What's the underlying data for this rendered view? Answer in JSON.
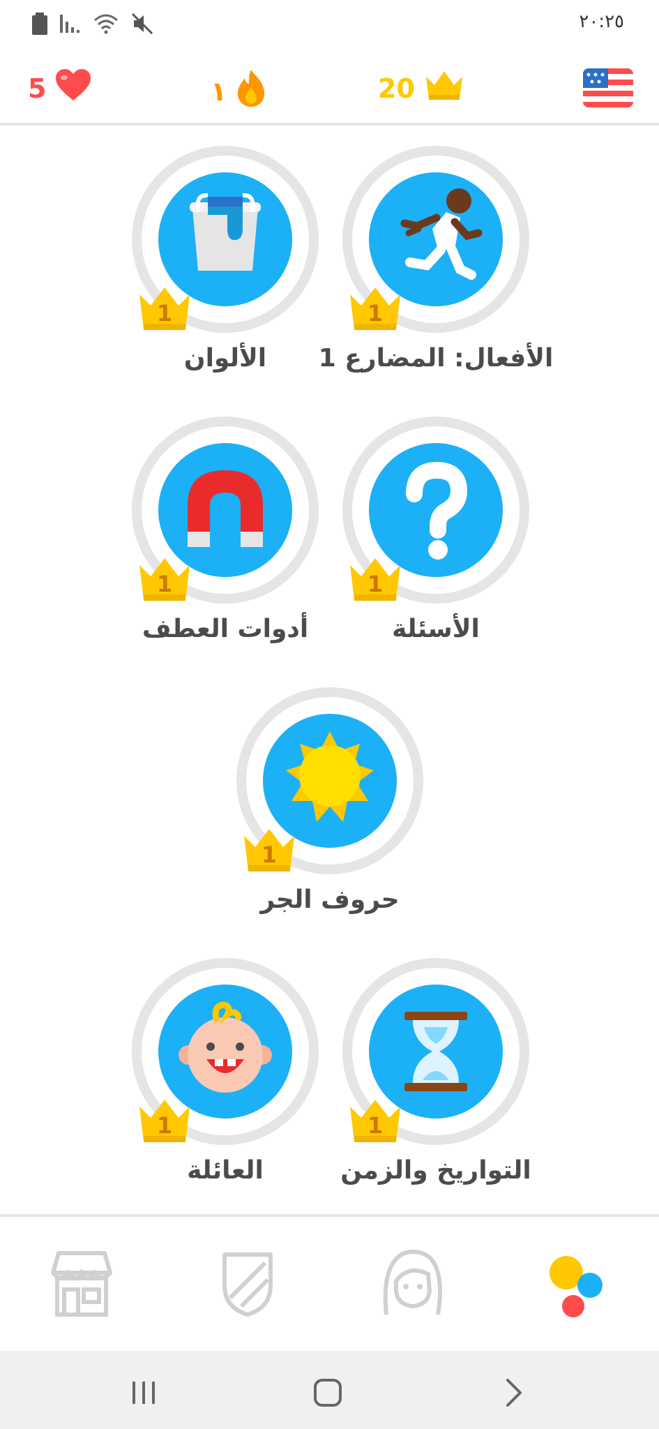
{
  "status_bar": {
    "time": "٢٠:٢٥",
    "icons": [
      "battery-icon",
      "signal-icon",
      "wifi-icon",
      "mute-icon"
    ]
  },
  "stats": {
    "hearts": "5",
    "streak": "١",
    "crowns": "20",
    "course_flag": "us-flag-icon"
  },
  "skills": [
    {
      "id": "verbs-present",
      "label": "الأفعال: المضارع 1",
      "level": "1",
      "icon": "running-person-icon"
    },
    {
      "id": "colors",
      "label": "الألوان",
      "level": "1",
      "icon": "paint-bucket-icon"
    },
    {
      "id": "questions",
      "label": "الأسئلة",
      "level": "1",
      "icon": "question-mark-icon"
    },
    {
      "id": "conjunctions",
      "label": "أدوات العطف",
      "level": "1",
      "icon": "magnet-icon"
    },
    {
      "id": "prepositions",
      "label": "حروف الجر",
      "level": "1",
      "icon": "sun-icon"
    },
    {
      "id": "dates-time",
      "label": "التواريخ والزمن",
      "level": "1",
      "icon": "hourglass-icon"
    },
    {
      "id": "family",
      "label": "العائلة",
      "level": "1",
      "icon": "baby-icon"
    }
  ],
  "bottom_nav": [
    "shop-icon",
    "shield-icon",
    "profile-icon",
    "learn-icon"
  ],
  "colors": {
    "skill_blue": "#1cb0f6",
    "ring_gray": "#e5e5e5",
    "crown_gold": "#ffc800",
    "heart_red": "#ff4b4b",
    "streak_orange": "#ff9600",
    "label_text": "#4b4b4b"
  }
}
